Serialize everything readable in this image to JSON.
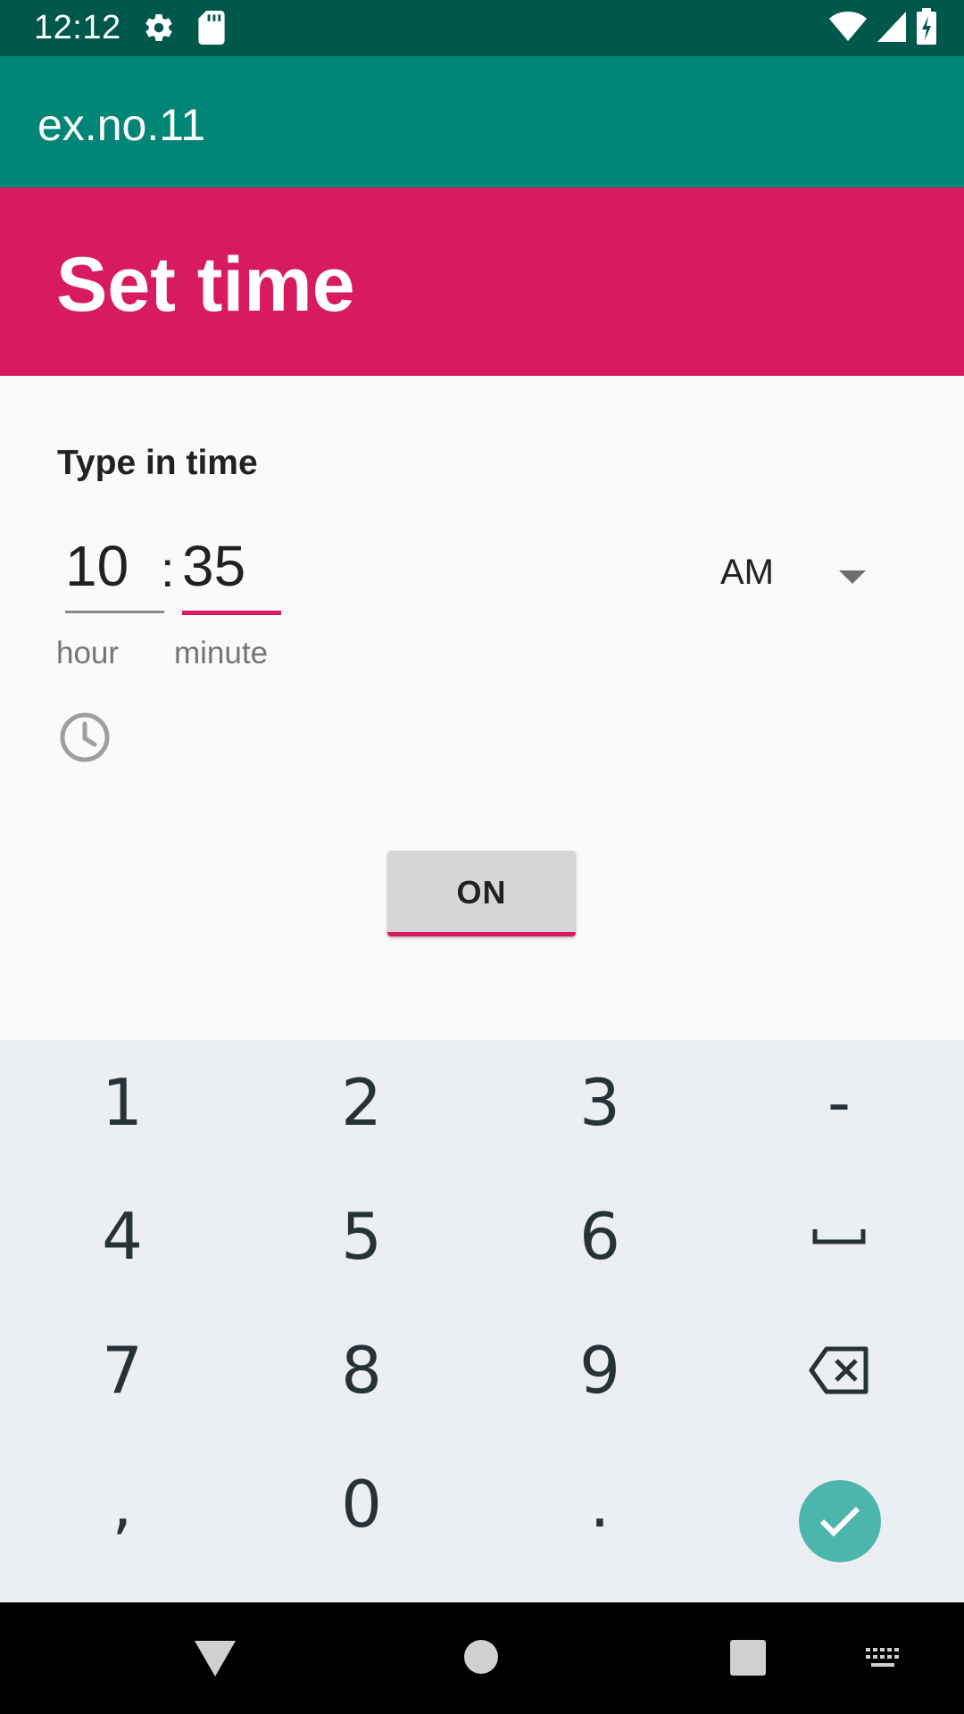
{
  "status_bar": {
    "time": "12:12",
    "icons": [
      "gear-icon",
      "sd-card-icon",
      "wifi-icon",
      "signal-icon",
      "battery-icon"
    ]
  },
  "app_bar": {
    "title": "ex.no.11"
  },
  "dialog": {
    "title": "Set time",
    "type_in_label": "Type in time",
    "hour_value": "10",
    "minute_value": "35",
    "separator": ":",
    "hour_caption": "hour",
    "minute_caption": "minute",
    "ampm_selected": "AM",
    "clock_toggle_icon": "clock-icon"
  },
  "main": {
    "toggle_button_label": "ON"
  },
  "keyboard": {
    "rows": [
      [
        "1",
        "2",
        "3",
        "-"
      ],
      [
        "4",
        "5",
        "6",
        "space-icon"
      ],
      [
        "7",
        "8",
        "9",
        "backspace-icon"
      ],
      [
        ",",
        "0",
        ".",
        "done-icon"
      ]
    ],
    "accent": "#4db6ac"
  },
  "nav_bar": {
    "icons": [
      "back-icon",
      "home-icon",
      "recents-icon",
      "keyboard-icon"
    ]
  },
  "colors": {
    "status_bar": "#00574b",
    "app_bar": "#008577",
    "dialog_header": "#d81b60",
    "accent": "#d81b60",
    "keyboard_bg": "#eceff1"
  }
}
